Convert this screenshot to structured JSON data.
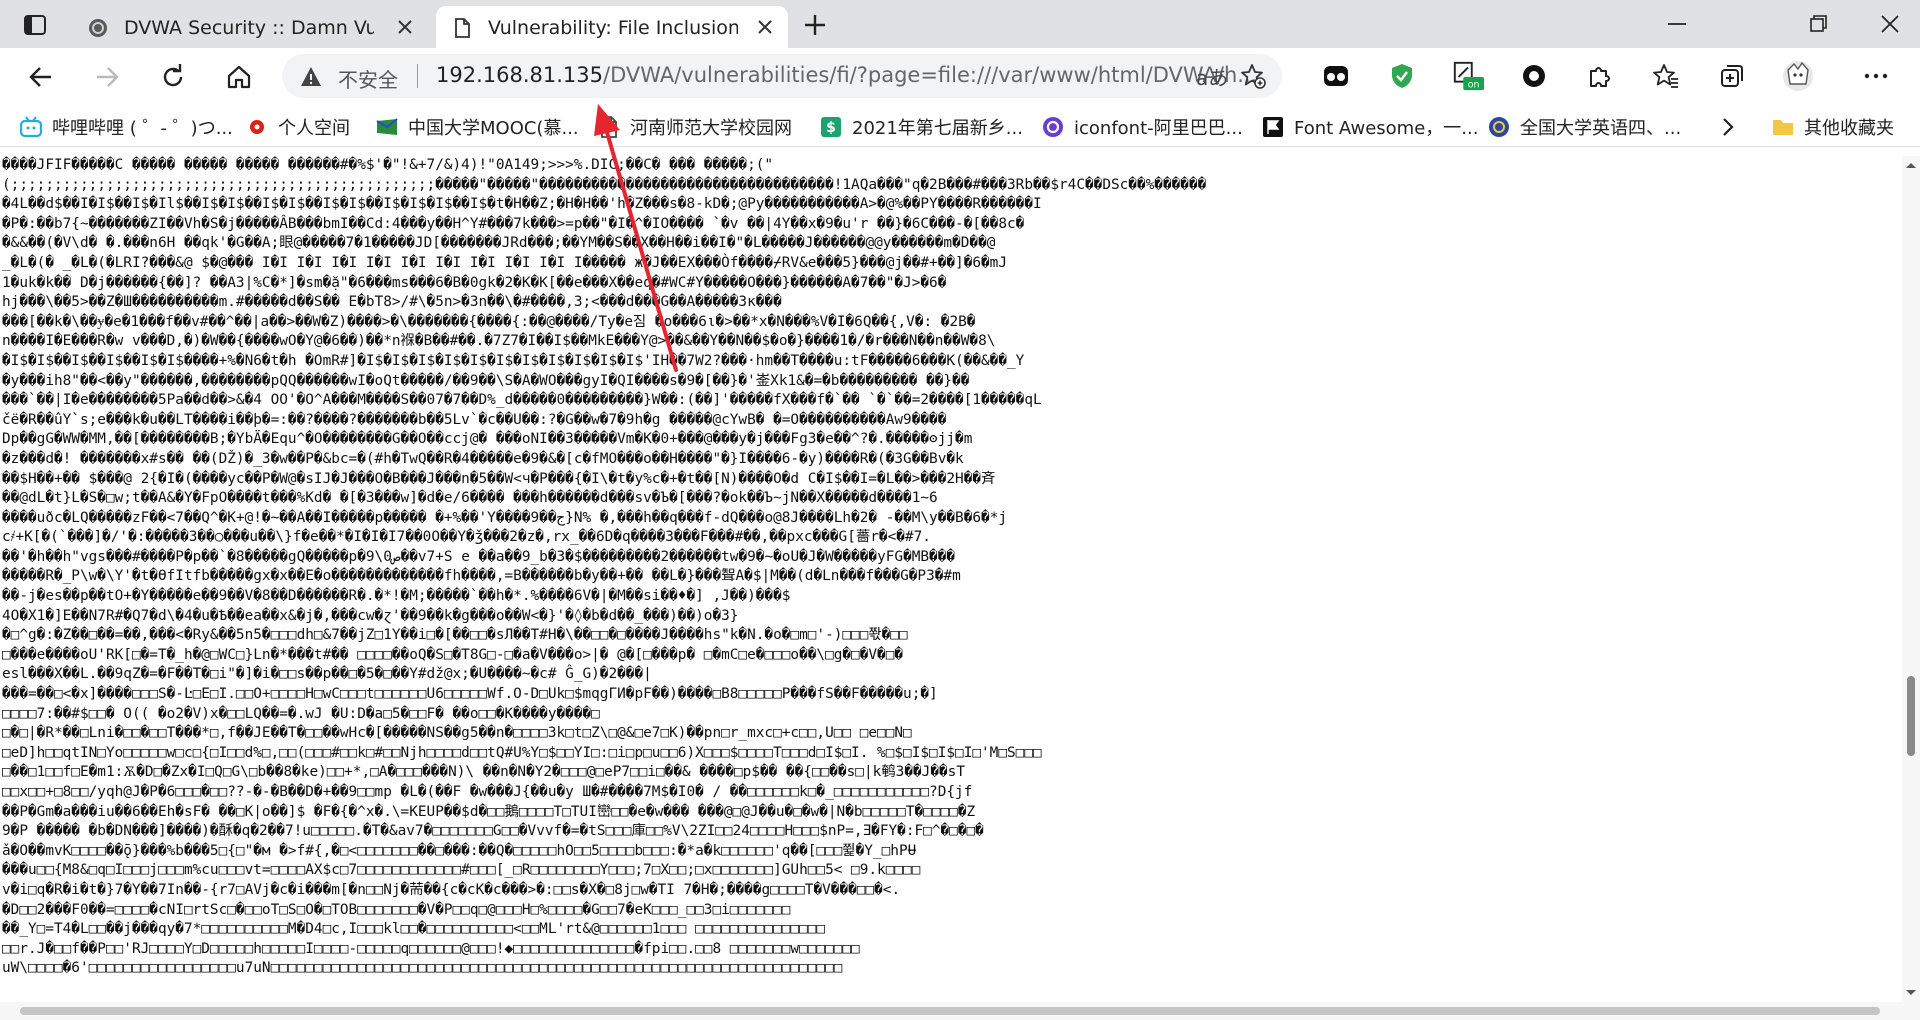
{
  "tabs": [
    {
      "title": "DVWA Security :: Damn Vulnerab",
      "active": false
    },
    {
      "title": "Vulnerability: File Inclusion :: Dan",
      "active": true
    }
  ],
  "toolbar": {
    "insecure_label": "不安全",
    "url_host": "192.168.81.135",
    "url_path": "/DVWA/vulnerabilities/fi/?page=file:///var/www/html/DVWA/h...",
    "read_aloud": "aあ",
    "extension_badge": "on"
  },
  "bookmarks": [
    {
      "label": "哔哩哔哩 ( ゜- ゜)つ...",
      "icon": "bilibili-icon",
      "color": "#23ade5"
    },
    {
      "label": "个人空间",
      "icon": "flower-icon",
      "color": "#d21"
    },
    {
      "label": "中国大学MOOC(慕...",
      "icon": "mooc-icon",
      "color": "#2a8a3a"
    },
    {
      "label": "河南师范大学校园网",
      "icon": "document-icon",
      "color": "#444"
    },
    {
      "label": "2021年第七届新乡...",
      "icon": "dollar-icon",
      "color": "#1aa36f"
    },
    {
      "label": "iconfont-阿里巴巴...",
      "icon": "iconfont-icon",
      "color": "#6a3cd1"
    },
    {
      "label": "Font Awesome，一...",
      "icon": "flag-icon",
      "color": "#111"
    },
    {
      "label": "全国大学英语四、...",
      "icon": "globe-icon",
      "color": "#2a4aa0"
    }
  ],
  "bookmarks_more": "其他收藏夹",
  "content_lines": [
    "����JFIF�����C ����� ����� ����� ������#�%$'�\"!&+7/&)4)!\"0A149;>>>%.DIC;��C� ��� �����;(\"",
    "(;;;;;;;;;;;;;;;;;;;;;;;;;;;;;;;;;;;;;;;;;;;;;;;;;�����\"�����\"����������������������������������!1AQa���\"q�2B���#���3Rb��$r4C��DSc��%������",
    "�4L��d$��I�I$��I$�Il$��I$�I$��I$�I$��I$�I$��I$�I$�I$��I$�t�H��Z;�H�H��'h�Z���s�8-kD�;@Py�����������A>�@%��PY����R������I",
    "�P�:��b7{~�������ZI��Vh�S�j�����ÂB���bmI��Cd:4���y��H^Y#���7k���>=p��\"�I�^�IO���� `�v ��|4Y��x�9�u'r ��}�6C���-�[��8c�",
    "�&&��(�V\\d� �.���n6H ��qk'�G��A;眼@�����7�1�����JD[�������JRd���;��YM��S��X��H��i��I�\"�L�����J������@@y������m�D��@",
    "_�L�(� _�L�(�LRI?���&@ $�@��� I�I I�I I�I I�I I�I I�I I�I I�I I�I I����� ж�J��EX���Òf����⌿RV&e���5}���@j��#+��]�6�mJ",
    "1�uk�k�� D�j������{��]? ��A3|%C�*]�sm�ặ\"�6���ms���6�B�0gk�2�K�K[��e���X��eq�#WC#Y�����O���}������A�7��\"�J>�6�",
    "hj���\\��5>��Z�Ш����������m.#�����d��S�� E�bT8>/#\\�5n>�3n��\\�#����,3;<���d���G��A�����3к���",
    "���[��k�\\��ɏ�e�1���f��v#��^��|a��>��W�Z)����>�\\�������{����{:��@����/Ty�e짐 �o���6ι�>��*x�N���%V�I�6Q��{,V�: �2B�",
    "n����I�E���R�w v���D,�)�W��{����wO�Y@�6��)��*n褓�B��#��.�7Z7�I��I$��MkE���Y@>��&��Y��N��$�o�}����1�/�r���N��n��W�8\\",
    "�I$�I$��I$��I$��I$�I$����+%�N6�t�h �OmR#]�I$�I$�I$�I$�I$�I$�I$�I$�I$�I$�I$'IH��7W2?���·hm��T����u:tF�����6���K(��&��_Y",
    "�y���ih8\"��<��y\"������,��������pQQ������wI�oQt�����/��9��\\S�A�WO���gyI�QI����s�9�[��}�'崟Xk1&�=�b��������� ��}��",
    "���`��|I�e��������5Pa��d��>&�4 OO'�O^A���M����S��07�7��D%_d�����0���������}W��:(��]'�����fX���f�`�� `�`��=2����[1�����qL",
    "čё�R��ûY`s;e���k�u��LT����i��þ�=:��?����?�������b��5Lv`�c��U��:?�G��w�7�9h�g �����@cYwB� �=O����������Aw9����",
    "Dp��gG�WW�MM,��[��������B;�YbÄ�Equ^�O��������G��O��ccj@� ���oNI��3�����Vm�K�0+���@���y�j���Fg3�e��^?�.�����ʘjj�m",
    "�z���d�! �������x#s�� ��(DŽ)�_3�w��P�&bc=�(#h�TwQ��R�4�����e�9�&�[c�fMO���o��H����\"�}I����6-�y)����R�(�3G��Bv�k",
    "��$H��+�� $���@ 2{�I�(����yc��P�W@�sIJ�J���O�B���J���n�5��W<ч�P���{�I\\�t�y%c�+�t��[N)����O�d C�I$��I=�L��>���2H��斉",
    "��@dL�t}L�S�□w;t��A&�Y�FpO����t���%Kd� �[�3���w]�d�e/6���� ���h������d���sv�Ъ�[���?�ok��Ъ~jN��X�����d����1~6",
    "����uðc�LQ�����zF��<7��Q^�K+@!�~��A��I�����p����� �+%��'Y����9��ج}N% �,���h��q���f-dQ���o@8J����Lh�2� -��M\\y��B�6�*j",
    "c҂+K[�(`���]�/'�:�����3��○���u��\\}f�e��*�I�I�I7��0O��Y�ǯ���2�z�,rx_��6D�q����3���F���#��,��pxc���G[薔r�<�#7.",
    "��'�h��h\"vgs���#����P�p��`�8�����gQ�����p�9\\ص0��v7+S e ��a��9_b�3�$���������2������tw�9�~�oU�J�W�����yFG�MB���",
    "�����R�_P\\w�\\Y'�t�ӨfItfb�����gx�x��E�o�������������fh����,=B������b�y��+�� ��L�}���聟A�$|M��(d�Ln���f���G�P3�#m",
    "��-j�es��p��tO+�Y�����e��9��V�8��D������R�.�*!�M;�����`��h�*.%����6V�|�M��si��♦�] ,J��)���$",
    "4O�X1�]E��N7R#�Q7�d\\�4�u�Ѣ��ea��x&�j�,���cw�ɀ'��9��k�g���o��W<�}'�◊�b�d��_���)��)o�3}",
    "�□^g�:�Z��□��=��,���<�Ry&��5n5�□□□dh□&7��jZ□1Y��i□�[��□□�sЛ��T#H�\\��□□�□����J����hs\"k�N.�o�□m□'-)□□□쫛�□□",
    "□���e����oU'RK[□�=T�_h�@□WC□}Ln�*���t#�� □□□□��oQ�S□�T8G□-□�a�V���o>|� @�[□���p� □�mC□e�□□□o��\\□g�□�V�□�",
    "esl���X��L.��9qZ�=�F��T�□i\"�]�i�□□s��p��□�5�□��Y#dž@x;�U����~�c# Ĝ_G)�2���|",
    "���=��□<�x]����□□□S�-Ŀ□E□I.□□O+□□□□H□wC□□□t□□□□□□U6□□□□□Wf.O-D□Uk□$mqgГИ�pF��)����□B8□□□□□P���fS��F�����u;�]",
    "□□□□7:��#$□□� O(( �o2�V)x�□□LQ��=�.wJ �U:D�a□5�□□F� ��o□□�K����y����□",
    "□�□|�R*��□Lni�□□�□□T���*□,f��JE��T�□□��wHc�[�����NS��g5��n�□□□□3k□t□Z\\□@&□e7□K)��pn□r_mxc□+c□□,U□□ □e□□N□",
    "□eD]h□□qtIN□Yo□□□□□w□c□{□I□□d%□,□□(□□□#□□k□#□□Njh□□□□d□□tQ#U%Y□$□□YI□:□i□p□u□□6)X□□□$□□□□T□□□d□I$□I. %□$□I$□I$□I□'M□S□□□",
    "□��□1□□f□E�m1:Ѫ�D□�Zx�I□Q□G\\□b��8�ke)□□+*,□A�□□□���N)\\ ��n�N�Y2�□□□@□eP7□□i□��& ����□p$�� ��{□□��s□|k鹌3��J��sT",
    "□□x□□+□8□□/yqh@J�P�6□□□�□□??-�-�B��D�+��9□□mp �L�(��F �w���J{��u�y Ш�#����7M$�I0� / ��□□□□□□k□�_□□□□□□□□□□□?D{jf",
    "��P�Gm�a���iu��6��Eh�sF� ��□K|o��]$ �F�{�^x�.\\=KEUP��$d�□□鵝□□□□T□TUI巒□□�e�w��� ���@□@J��u�□�w�|N�b□□□□□T�□□□□�Z",
    "9�P ����� �b�DN���]����)�酥�q�2��7!u□□□□□.�T�&av7�□□□□□□□G□□�Vvvf�=�tS□□□庫□□%V\\2ZI□□24□□□□H□□□$nP=,Ǝ�FY�:F□^�□�□�",
    "ǎ�O��mvK□□□□��ǭ}���%b���5□{□\"�м �>f#{,�□<□□□□□□□��□���:��Q�□□□□□hO□□5□□□□b□□□:�*a�k□□□□□□'q��[□□□쮩�Y_□hPɄ",
    "���u□□{M8&□q□I□□□j□□□m%cu□□□vt=□□□□AX$c□7□□□□□□□□□□□□#□□□[_□R□□□□□□□□Y□□□;7□X□□;□x□□□□□□□]GUh□□5< □9.k□□□□",
    "v�i□q�R�i�t�}7�Y��7In��-{r7□AVj�c�i���m[�n□□Nj�荋��{c�cK�c���>�:□□s�X�□8j□w�TI 7�H�;����g□□□□T�V���□□�<.",
    "�D□□2���F0��=□□□□�cNI□rtSc□�□□oT□S□O�□TOB□□□□□□□�V�P□□q□@□□□H□%□□□□�G□□7�eK□□□_□□3□i□□□□□□□",
    "��_Y□=T4�L□□��j���qy�7*□□□□□□□□□□M�D4□c,I□□□kl□□�□□□□□□□□□□<□□ML'rt&@□□□□□□1□□□ □□□□□□□□□□□□□□□",
    "□□r.J�□□f��P□□'RJ□□□□Y□D□□□□□h□□□□□I□□□□-□□□□□q□□□□□□@□□□!◆□□□□□□□□□□□□□□�fpi□□.□□8 □□□□□□□w□□□□□□□",
    "uW\\□□□□�6'□□□□□□□□□□□□□□□□□u7uN□□□□□□□□□□□□□□□□□□□□□□□□□□□□□□□□□□□□□□□□□□□□□□□□□□□□□□□□□□□□□□□□□□"
  ]
}
